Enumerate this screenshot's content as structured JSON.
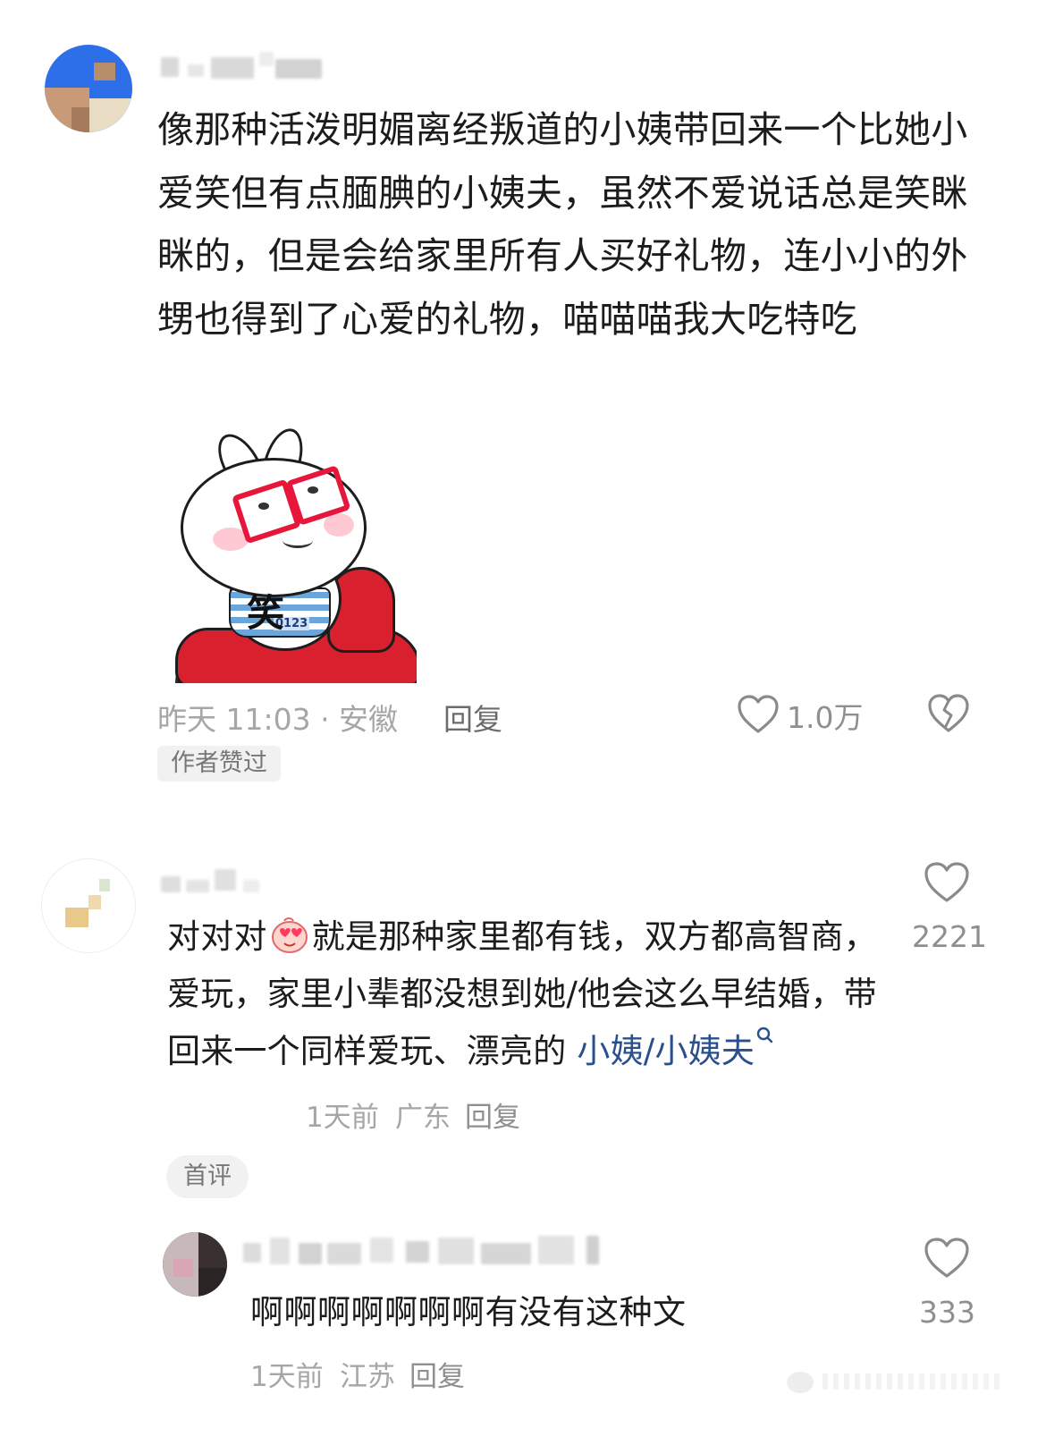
{
  "comment1": {
    "text": "像那种活泼明媚离经叛道的小姨带回来一个比她小爱笑但有点腼腆的小姨夫，虽然不爱说话总是笑眯眯的，但是会给家里所有人买好礼物，连小小的外甥也得到了心爱的礼物，喵喵喵我大吃特吃",
    "sticker_caption": "笑",
    "sticker_badge": "0123",
    "time": "昨天 11:03 · 安徽",
    "reply_label": "回复",
    "like_count": "1.0万",
    "tag": "作者赞过"
  },
  "comment2": {
    "text_before_emoji": "对对对",
    "text_after_emoji": "就是那种家里都有钱，双方都高智商，爱玩，家里小辈都没想到她/他会这么早结婚，带回来一个同样爱玩、漂亮的 ",
    "link_text": "小姨/小姨夫",
    "link_icon": "search-icon",
    "time": "1天前",
    "location": "广东",
    "reply_label": "回复",
    "like_count": "2221",
    "tag": "首评"
  },
  "reply1": {
    "text": "啊啊啊啊啊啊啊有没有这种文",
    "time": "1天前",
    "location": "江苏",
    "reply_label": "回复",
    "like_count": "333"
  },
  "colors": {
    "link": "#2a4f8c",
    "meta": "#a6a6a6",
    "sticker_red": "#d8202f"
  }
}
